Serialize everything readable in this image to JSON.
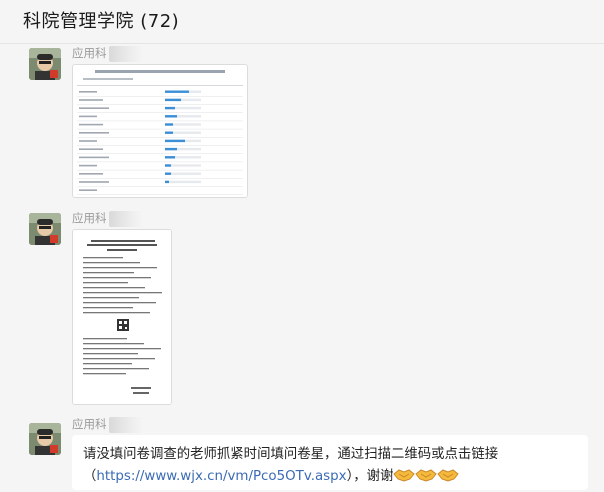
{
  "header": {
    "title": "科院管理学院 (72)"
  },
  "messages": [
    {
      "sender": "应用科",
      "type": "image",
      "content": "survey-results-screenshot"
    },
    {
      "sender": "应用科",
      "type": "image",
      "content": "notice-document-with-qr"
    },
    {
      "sender": "应用科",
      "type": "text",
      "text_before": "请没填问卷调查的老师抓紧时间填问卷星，通过扫描二维码或点击链接（",
      "link": "https://www.wjx.cn/vm/Pco5OTv.aspx",
      "text_after": "），谢谢"
    }
  ],
  "colors": {
    "link": "#3b6bb5",
    "background": "#f5f5f5",
    "bubble": "#ffffff",
    "bar": "#3b8fd6"
  },
  "icons": {
    "emoji": "handshake-emoji"
  }
}
